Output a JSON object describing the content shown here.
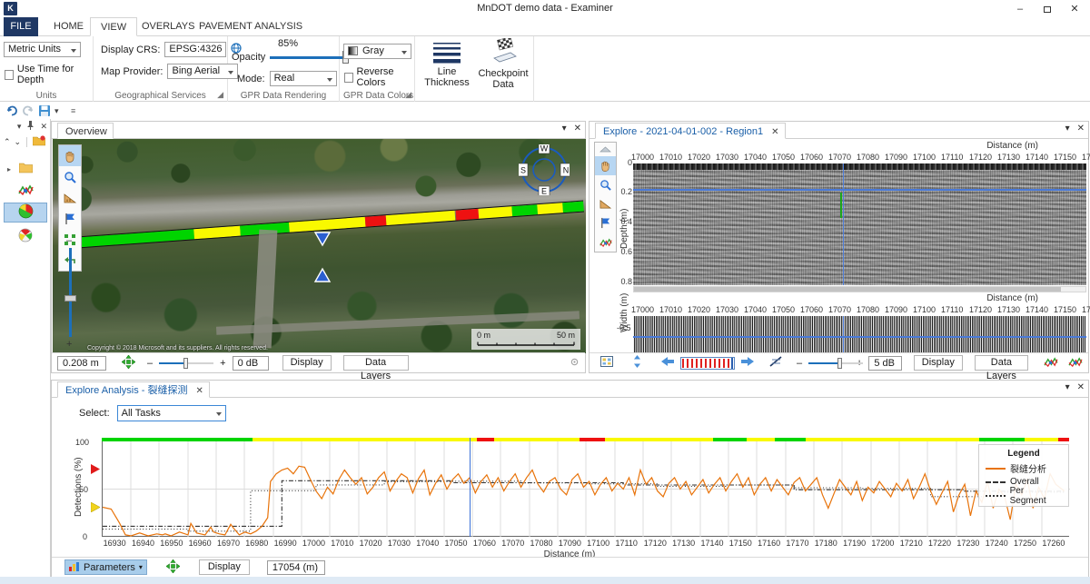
{
  "window": {
    "title": "MnDOT demo data - Examiner",
    "logo_text": "K",
    "minimize": "–",
    "maximize": "❐",
    "close": "✕"
  },
  "ribbon": {
    "tabs": [
      {
        "label": "FILE",
        "active": false
      },
      {
        "label": "HOME",
        "active": false
      },
      {
        "label": "VIEW",
        "active": true
      },
      {
        "label": "OVERLAYS",
        "active": false
      },
      {
        "label": "PAVEMENT ANALYSIS",
        "active": false
      }
    ],
    "collapse_icon": "⌃",
    "help_icon": "?",
    "groups": [
      {
        "name": "Units",
        "units_combo": "Metric Units",
        "use_time_for_depth": "Use Time for Depth"
      },
      {
        "name": "Geographical Services",
        "display_crs_label": "Display CRS:",
        "display_crs_value": "EPSG:4326",
        "map_provider_label": "Map Provider:",
        "map_provider_value": "Bing Aerial"
      },
      {
        "name": "GPR Data Rendering",
        "opacity_label": "Opacity",
        "opacity_value": "85%",
        "mode_label": "Mode:",
        "mode_value": "Real"
      },
      {
        "name": "GPR Data Colors",
        "palette_value": "Gray",
        "reverse_colors": "Reverse Colors"
      },
      {
        "name": "",
        "line_thickness": "Line\nThickness",
        "checkpoint_data": "Checkpoint\nData"
      }
    ],
    "line_thickness_label_1": "Line",
    "line_thickness_label_2": "Thickness",
    "checkpoint_label_1": "Checkpoint",
    "checkpoint_label_2": "Data"
  },
  "quick_access": {
    "undo_icon": "undo-icon",
    "redo_icon": "redo-icon",
    "save_icon": "save-icon",
    "dropdown_icon": "chevron-down-icon",
    "overflow_icon": "overflow-icon"
  },
  "left_nav": {
    "pin_icon": "pin-icon",
    "close_icon": "close-icon",
    "dropdown_icon": "chevron-down-icon",
    "collapse_icon": "collapse-all-icon",
    "expand_icon": "expand-all-icon",
    "items": [
      {
        "name": "project-folder-icon",
        "selected": false
      },
      {
        "name": "folder-icon",
        "selected": false
      },
      {
        "name": "gpr-tracks-icon",
        "selected": false
      },
      {
        "name": "pie-analysis-icon",
        "selected": true
      },
      {
        "name": "layers-icon",
        "selected": false
      }
    ]
  },
  "overview_panel": {
    "tab_label": "Overview",
    "dropdown_icon": "chevron-down-icon",
    "close_icon": "close-icon",
    "tools": [
      {
        "name": "pan-hand-icon",
        "selected": true
      },
      {
        "name": "zoom-magnifier-icon",
        "selected": false
      },
      {
        "name": "measure-ruler-icon",
        "selected": false
      },
      {
        "name": "flag-marker-icon",
        "selected": false
      },
      {
        "name": "select-region-icon",
        "selected": false
      },
      {
        "name": "undo-view-icon",
        "selected": false
      }
    ],
    "zoom_minus": "–",
    "zoom_plus": "+",
    "compass": {
      "n": "N",
      "e": "E",
      "s": "S",
      "w": "W"
    },
    "scalebar": {
      "min": "0 m",
      "max": "50 m"
    },
    "copyright": "Copyright © 2018 Microsoft and its suppliers. All rights reserved.",
    "statusbar": {
      "resolution": "0.208 m",
      "center_icon": "center-map-icon",
      "gain_minus": "–",
      "gain_plus": "+",
      "gain_value": "0 dB",
      "display_button": "Display",
      "data_layers_button": "Data Layers",
      "settings_icon": "settings-icon"
    }
  },
  "explore_panel": {
    "tab_label": "Explore - 2021-04-01-002 - Region1",
    "close_tab_icon": "close-icon",
    "dropdown_icon": "chevron-down-icon",
    "close_icon": "close-icon",
    "collapse_icon": "collapse-up-icon",
    "tools": [
      {
        "name": "pan-hand-icon",
        "selected": true
      },
      {
        "name": "zoom-magnifier-icon",
        "selected": false
      },
      {
        "name": "measure-ruler-icon",
        "selected": false
      },
      {
        "name": "flag-marker-icon",
        "selected": false
      },
      {
        "name": "gpr-tracks-icon",
        "selected": false
      }
    ],
    "radargram": {
      "x_axis_label": "Distance (m)",
      "x_ticks": [
        "17000",
        "17010",
        "17020",
        "17030",
        "17040",
        "17050",
        "17060",
        "17070",
        "17080",
        "17090",
        "17100",
        "17110",
        "17120",
        "17130",
        "17140",
        "17150",
        "17"
      ],
      "y_axis_label": "Depth (m)",
      "y_ticks": [
        "0",
        "0.2",
        "0.4",
        "0.6",
        "0.8"
      ]
    },
    "widthgram": {
      "x_axis_label": "Distance (m)",
      "x_ticks": [
        "17000",
        "17010",
        "17020",
        "17030",
        "17040",
        "17050",
        "17060",
        "17070",
        "17080",
        "17090",
        "17100",
        "17110",
        "17120",
        "17130",
        "17140",
        "17150",
        "17"
      ],
      "y_axis_label": "Width (m)",
      "y_ticks": [
        "-0.5"
      ]
    },
    "statusbar": {
      "grid_icon": "grid-toggle-icon",
      "flip_icon": "flip-vertical-icon",
      "prev_icon": "arrow-left-icon",
      "scan_strip_icon": "scan-strip-icon",
      "next_icon": "arrow-right-icon",
      "picks_icon": "picks-icon",
      "gain_minus": "–",
      "gain_plus": "+",
      "gain_value": "5 dB",
      "display_button": "Display",
      "data_layers_button": "Data Layers",
      "tracks_icon_1": "gpr-tracks-icon",
      "tracks_icon_2": "gpr-tracks-icon"
    }
  },
  "analysis_panel": {
    "tab_label": "Explore Analysis - 裂缝探测",
    "close_tab_icon": "close-icon",
    "dropdown_icon": "chevron-down-icon",
    "close_icon": "close-icon",
    "select_label": "Select:",
    "select_value": "All Tasks",
    "statusbar": {
      "parameters_button": "Parameters",
      "parameters_icon": "parameters-icon",
      "center_icon": "center-map-icon",
      "display_button": "Display",
      "position_value": "17054 (m)"
    }
  },
  "chart_data": {
    "type": "line",
    "title": "",
    "xlabel": "Distance (m)",
    "ylabel": "Detections (%)",
    "xlim": [
      16925,
      17265
    ],
    "ylim": [
      0,
      100
    ],
    "y_ticks": [
      0,
      50,
      100
    ],
    "x_ticks": [
      16930,
      16940,
      16950,
      16960,
      16970,
      16980,
      16990,
      17000,
      17010,
      17020,
      17030,
      17040,
      17050,
      17060,
      17070,
      17080,
      17090,
      17100,
      17110,
      17120,
      17130,
      17140,
      17150,
      17160,
      17170,
      17180,
      17190,
      17200,
      17210,
      17220,
      17230,
      17240,
      17250,
      17260
    ],
    "grid": true,
    "legend_position": "top-right",
    "legend_title": "Legend",
    "series": [
      {
        "name": "裂缝分析",
        "style": "solid",
        "color": "#e8730a",
        "x": [
          16925,
          16928,
          16931,
          16933,
          16935,
          16938,
          16941,
          16944,
          16946,
          16947,
          16949,
          16952,
          16955,
          16956,
          16958,
          16961,
          16963,
          16964,
          16966,
          16968,
          16970,
          16971,
          16973,
          16975,
          16977,
          16979,
          16981,
          16983,
          16984,
          16986,
          16988,
          16990,
          16992,
          16994,
          16996,
          16998,
          17000,
          17002,
          17004,
          17006,
          17008,
          17010,
          17012,
          17014,
          17016,
          17018,
          17020,
          17022,
          17024,
          17026,
          17028,
          17030,
          17032,
          17034,
          17036,
          17038,
          17040,
          17042,
          17044,
          17046,
          17048,
          17050,
          17052,
          17054,
          17056,
          17058,
          17060,
          17062,
          17064,
          17066,
          17068,
          17070,
          17072,
          17074,
          17076,
          17078,
          17080,
          17082,
          17084,
          17086,
          17088,
          17090,
          17092,
          17094,
          17096,
          17098,
          17100,
          17102,
          17104,
          17106,
          17108,
          17110,
          17112,
          17114,
          17116,
          17118,
          17120,
          17122,
          17124,
          17126,
          17128,
          17130,
          17132,
          17134,
          17136,
          17138,
          17140,
          17142,
          17144,
          17146,
          17148,
          17150,
          17152,
          17154,
          17156,
          17158,
          17160,
          17162,
          17164,
          17166,
          17168,
          17170,
          17172,
          17174,
          17176,
          17178,
          17180,
          17182,
          17184,
          17186,
          17188,
          17190,
          17192,
          17194,
          17196,
          17198,
          17200,
          17202,
          17204,
          17206,
          17208,
          17210,
          17212,
          17214,
          17216,
          17218,
          17220,
          17222,
          17224,
          17226,
          17228,
          17230,
          17232,
          17234,
          17236,
          17238,
          17240,
          17242,
          17244,
          17246,
          17248,
          17250,
          17252,
          17254,
          17256,
          17258,
          17260,
          17263
        ],
        "y": [
          31,
          29,
          14,
          2,
          1,
          4,
          1,
          3,
          2,
          3,
          1,
          5,
          2,
          14,
          4,
          2,
          10,
          5,
          3,
          2,
          13,
          9,
          2,
          5,
          3,
          6,
          11,
          20,
          58,
          66,
          70,
          72,
          66,
          74,
          73,
          60,
          48,
          40,
          52,
          45,
          60,
          70,
          62,
          55,
          62,
          45,
          52,
          62,
          68,
          48,
          58,
          66,
          62,
          46,
          61,
          70,
          44,
          56,
          65,
          50,
          60,
          66,
          56,
          62,
          46,
          58,
          65,
          52,
          62,
          48,
          58,
          66,
          52,
          62,
          70,
          55,
          47,
          58,
          62,
          50,
          44,
          60,
          66,
          52,
          58,
          44,
          55,
          62,
          48,
          56,
          50,
          62,
          44,
          70,
          55,
          62,
          48,
          42,
          56,
          62,
          50,
          58,
          44,
          52,
          60,
          46,
          55,
          62,
          48,
          58,
          66,
          52,
          62,
          44,
          55,
          62,
          48,
          60,
          52,
          44,
          57,
          62,
          48,
          55,
          62,
          44,
          30,
          45,
          60,
          52,
          44,
          58,
          38,
          52,
          46,
          58,
          50,
          42,
          56,
          48,
          60,
          40,
          52,
          66,
          48,
          34,
          46,
          58,
          26,
          44,
          55,
          22,
          48,
          36,
          58,
          30,
          50,
          42,
          18,
          55,
          44,
          60,
          30,
          52,
          40,
          66,
          55,
          48,
          72,
          76
        ]
      },
      {
        "name": "Overall",
        "style": "dash-dot",
        "color": "#333333",
        "description": "Overall average step line"
      },
      {
        "name": "Per Segment",
        "style": "dotted",
        "color": "#333333",
        "description": "Per-segment average step line"
      }
    ],
    "threshold_markers": [
      {
        "name": "red-threshold-marker",
        "value": 70,
        "color": "#e01b1b"
      },
      {
        "name": "yellow-threshold-marker",
        "value": 30,
        "color": "#f1d31c"
      }
    ],
    "cursor": {
      "x": 17054,
      "color": "#3a6fd8"
    },
    "condition_strip": [
      {
        "from": 16925,
        "to": 16978,
        "color": "#00d400"
      },
      {
        "from": 16978,
        "to": 17057,
        "color": "#f9f900"
      },
      {
        "from": 17057,
        "to": 17063,
        "color": "#ee1111"
      },
      {
        "from": 17063,
        "to": 17093,
        "color": "#f9f900"
      },
      {
        "from": 17093,
        "to": 17102,
        "color": "#ee1111"
      },
      {
        "from": 17102,
        "to": 17140,
        "color": "#f9f900"
      },
      {
        "from": 17140,
        "to": 17152,
        "color": "#00d400"
      },
      {
        "from": 17152,
        "to": 17162,
        "color": "#f9f900"
      },
      {
        "from": 17162,
        "to": 17173,
        "color": "#00d400"
      },
      {
        "from": 17173,
        "to": 17234,
        "color": "#f9f900"
      },
      {
        "from": 17234,
        "to": 17250,
        "color": "#00d400"
      },
      {
        "from": 17250,
        "to": 17262,
        "color": "#f9f900"
      },
      {
        "from": 17262,
        "to": 17265,
        "color": "#ee1111"
      }
    ]
  },
  "map_condition_strip": [
    {
      "pct_from": 0.0,
      "pct_to": 24.0,
      "color": "#00d400"
    },
    {
      "pct_from": 24.0,
      "pct_to": 33.0,
      "color": "#f9f900"
    },
    {
      "pct_from": 33.0,
      "pct_to": 42.5,
      "color": "#00d400"
    },
    {
      "pct_from": 42.5,
      "pct_to": 57.5,
      "color": "#f9f900"
    },
    {
      "pct_from": 57.5,
      "pct_to": 61.5,
      "color": "#ee1111"
    },
    {
      "pct_from": 61.5,
      "pct_to": 75.0,
      "color": "#f9f900"
    },
    {
      "pct_from": 75.0,
      "pct_to": 79.5,
      "color": "#ee1111"
    },
    {
      "pct_from": 79.5,
      "pct_to": 86.0,
      "color": "#f9f900"
    },
    {
      "pct_from": 86.0,
      "pct_to": 91.0,
      "color": "#00d400"
    },
    {
      "pct_from": 91.0,
      "pct_to": 96.0,
      "color": "#f9f900"
    },
    {
      "pct_from": 96.0,
      "pct_to": 100.0,
      "color": "#00d400"
    }
  ]
}
